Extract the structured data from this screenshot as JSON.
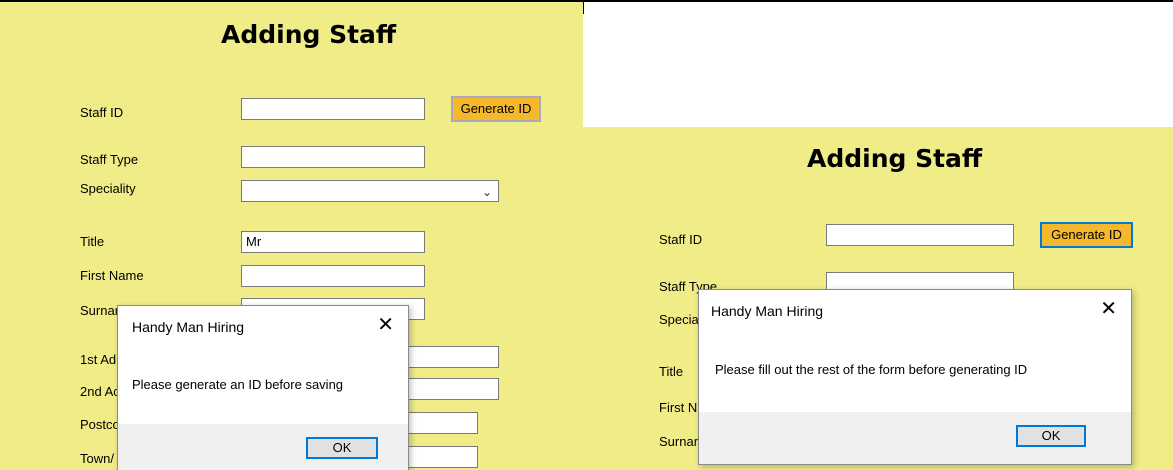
{
  "left_screen": {
    "title": "Adding Staff",
    "labels": {
      "staff_id": "Staff ID",
      "staff_type": "Staff Type",
      "speciality": "Speciality",
      "title": "Title",
      "first_name": "First Name",
      "surname": "Surnar",
      "addr1": "1st Adı",
      "addr2": "2nd Ac",
      "postcode": "Postco",
      "town": "Town/"
    },
    "fields": {
      "staff_id": "",
      "staff_type": "",
      "speciality": "",
      "title": "Mr",
      "first_name": "",
      "surname": "",
      "addr1": "",
      "addr2": "",
      "postcode": "",
      "town": ""
    },
    "generate_button": "Generate ID",
    "dialog": {
      "title": "Handy Man Hiring",
      "close": "✕",
      "message": "Please generate an ID before saving",
      "ok": "OK"
    }
  },
  "right_screen": {
    "title": "Adding Staff",
    "labels": {
      "staff_id": "Staff ID",
      "staff_type": "Staff Type",
      "speciality": "Specia",
      "title": "Title",
      "first_name": "First N",
      "surname": "Surnar"
    },
    "fields": {
      "staff_id": "",
      "staff_type": ""
    },
    "generate_button": "Generate ID",
    "dialog": {
      "title": "Handy Man Hiring",
      "close": "✕",
      "message": "Please fill out the rest of the form before generating ID",
      "ok": "OK"
    }
  },
  "colors": {
    "panel_bg": "#f0ed88",
    "button_bg": "#f5b82a",
    "focus_border": "#0078d7",
    "dialog_footer": "#f0f0f0"
  }
}
